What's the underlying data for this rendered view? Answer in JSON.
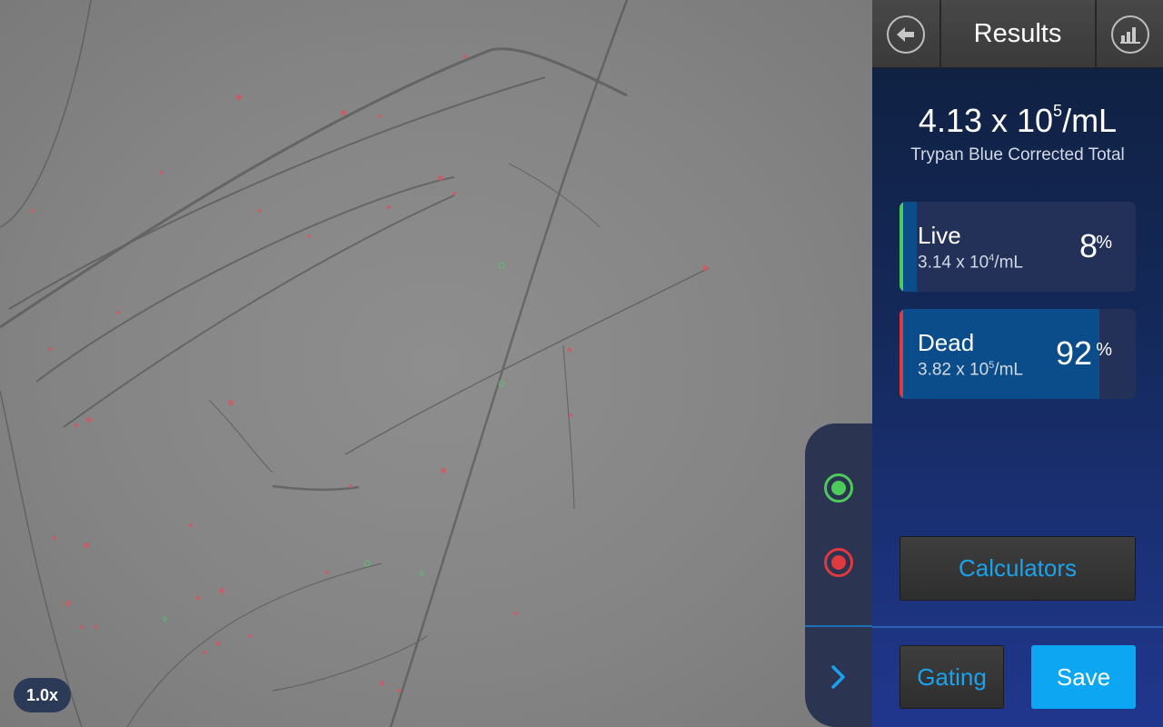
{
  "image": {
    "zoom_label": "1.0x"
  },
  "overlay": {
    "live_color": "#4ccb5a",
    "dead_color": "#e0393f",
    "expand_icon": "chevron-right-icon"
  },
  "header": {
    "back_icon": "back-arrow-icon",
    "title": "Results",
    "chart_icon": "bar-chart-icon"
  },
  "summary": {
    "total_value": "4.13 x 10",
    "total_exponent": "5",
    "total_unit": "/mL",
    "total_label": "Trypan Blue Corrected Total"
  },
  "results": {
    "live": {
      "label": "Live",
      "conc_value": "3.14 x 10",
      "conc_exponent": "4",
      "conc_unit": "/mL",
      "percent": "8",
      "percent_sign": "%",
      "fraction": 0.08,
      "accent_color": "#4ccb5a"
    },
    "dead": {
      "label": "Dead",
      "conc_value": "3.82 x 10",
      "conc_exponent": "5",
      "conc_unit": "/mL",
      "percent": "92",
      "percent_sign": "%",
      "fraction": 0.92,
      "accent_color": "#e0393f"
    }
  },
  "actions": {
    "calculators_label": "Calculators",
    "gating_label": "Gating",
    "save_label": "Save"
  },
  "colors": {
    "accent": "#0da6f2",
    "link_text": "#19a3ee"
  }
}
